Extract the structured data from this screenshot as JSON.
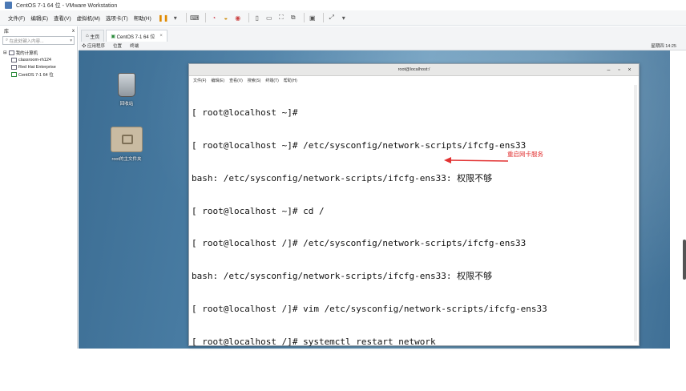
{
  "window": {
    "title": "CentOS 7-1 64 位 - VMware Workstation"
  },
  "menubar": {
    "items": [
      "文件(F)",
      "编辑(E)",
      "查看(V)",
      "虚拟机(M)",
      "选项卡(T)",
      "帮助(H)"
    ]
  },
  "library": {
    "title": "库",
    "close": "x",
    "search_placeholder": "在此处键入内容...",
    "tree": [
      "我的计算机",
      "classroom-rh124",
      "Red Hat Enterprise",
      "CentOS 7-1 64 位"
    ]
  },
  "tabs": [
    {
      "label": "主页",
      "icon": "home-icon",
      "close": ""
    },
    {
      "label": "CentOS 7-1 64 位",
      "icon": "vm-icon",
      "close": "×"
    }
  ],
  "gnome_bar": {
    "apps": "应用程序",
    "places": "位置",
    "terminal": "终端",
    "clock": "星期四 14:25"
  },
  "desktop": {
    "trash_label": "回收站",
    "home_label": "root的主文件夹"
  },
  "terminal": {
    "title": "root@localhost:/",
    "menu": [
      "文件(F)",
      "编辑(E)",
      "查看(V)",
      "搜索(S)",
      "终端(T)",
      "帮助(H)"
    ],
    "lines": [
      "[ root@localhost ~]#",
      "[ root@localhost ~]# /etc/sysconfig/network-scripts/ifcfg-ens33",
      "bash: /etc/sysconfig/network-scripts/ifcfg-ens33: 权限不够",
      "[ root@localhost ~]# cd /",
      "[ root@localhost /]# /etc/sysconfig/network-scripts/ifcfg-ens33",
      "bash: /etc/sysconfig/network-scripts/ifcfg-ens33: 权限不够",
      "[ root@localhost /]# vim /etc/sysconfig/network-scripts/ifcfg-ens33",
      "[ root@localhost /]# systemctl restart network"
    ],
    "annotation": "重启网卡服务"
  },
  "colors": {
    "annotation": "#e23232",
    "desktop": "#4b7fa6"
  }
}
